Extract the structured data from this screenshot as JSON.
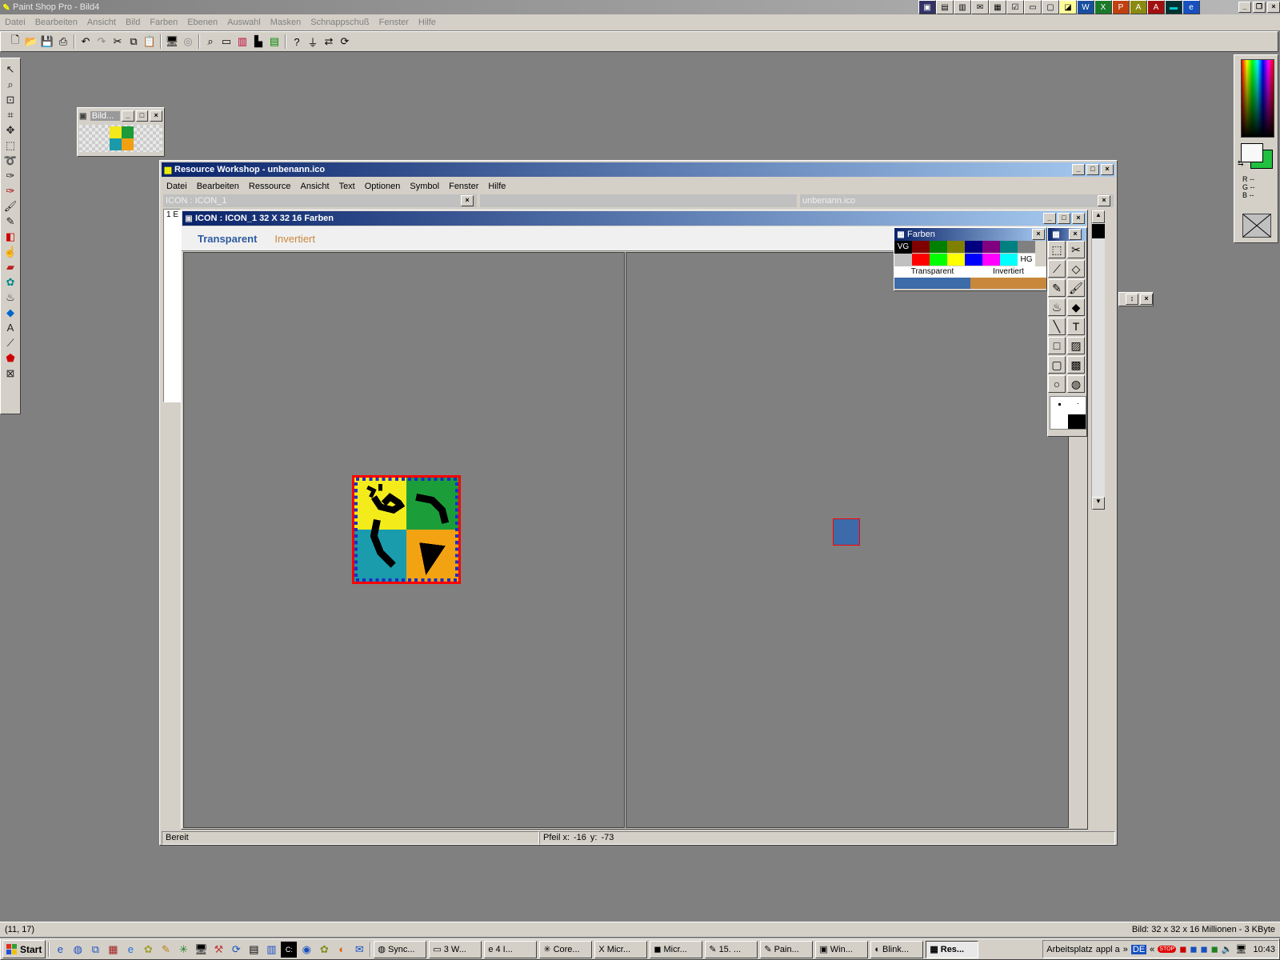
{
  "psp": {
    "title": "Paint Shop Pro - Bild4",
    "menu": [
      "Datei",
      "Bearbeiten",
      "Ansicht",
      "Bild",
      "Farben",
      "Ebenen",
      "Auswahl",
      "Masken",
      "Schnappschuß",
      "Fenster",
      "Hilfe"
    ],
    "status_left": "(11, 17)",
    "status_right": "Bild:  32 x 32 x 16 Millionen - 3 KByte",
    "rgb_r": "R --",
    "rgb_g": "G --",
    "rgb_b": "B --"
  },
  "thumb_window": {
    "title": "Bild..."
  },
  "rw": {
    "title": "Resource Workshop - unbenann.ico",
    "menu": [
      "Datei",
      "Bearbeiten",
      "Ressource",
      "Ansicht",
      "Text",
      "Optionen",
      "Symbol",
      "Fenster",
      "Hilfe"
    ],
    "pane_left_title": "ICON : ICON_1",
    "pane_right_title": "unbenann.ico",
    "pane_left_snippet": "1 E",
    "status_ready": "Bereit",
    "status_pos_label": "Pfeil  x:",
    "status_x": "-16",
    "status_y_label": "y:",
    "status_y": "-73"
  },
  "icon_editor": {
    "title": "ICON : ICON_1  32 X 32  16 Farben",
    "label_transparent": "Transparent",
    "label_inverted": "Invertiert",
    "color_transparent": "#3d6aa8",
    "color_inverted": "#c8883c"
  },
  "farben": {
    "title": "Farben",
    "fg_label": "VG",
    "bg_label": "HG",
    "transparent_label": "Transparent",
    "inverted_label": "Invertiert",
    "row1": [
      "#800000",
      "#008000",
      "#808000",
      "#000080",
      "#800080",
      "#008080",
      "#808080"
    ],
    "row2": [
      "#ff0000",
      "#00ff00",
      "#ffff00",
      "#0000ff",
      "#ff00ff",
      "#00ffff"
    ]
  },
  "taskbar": {
    "start_label": "Start",
    "items": [
      "Sync...",
      "3 W...",
      "4 I...",
      "Core...",
      "Micr...",
      "Micr...",
      "15. ...",
      "Pain...",
      "Win...",
      "Blink...",
      "Res..."
    ],
    "desk_label": "Arbeitsplatz",
    "appl_label": "appl a",
    "lang": "DE",
    "clock": "10:43"
  }
}
